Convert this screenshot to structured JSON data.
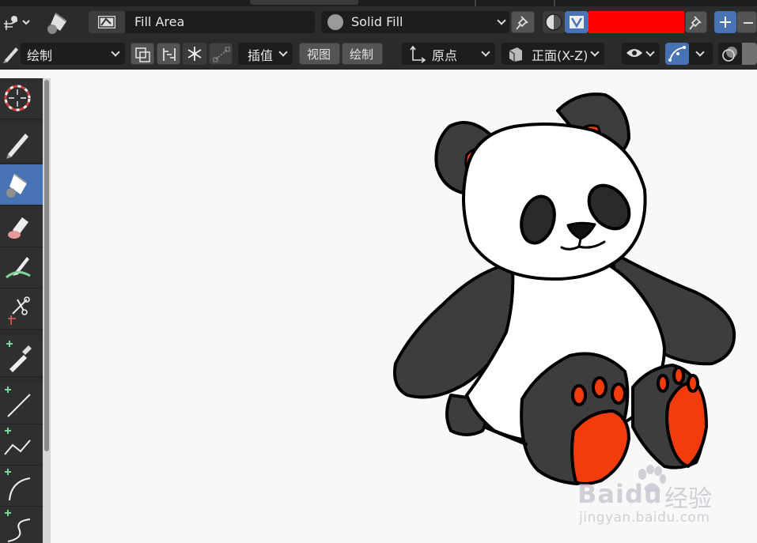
{
  "header": {
    "fill_label": "Fill Area",
    "material_mode": "Solid Fill",
    "swatch_color": "#ff0000"
  },
  "tool_settings": {
    "mode": "绘制",
    "interpolate": "插值",
    "view": "视图",
    "draw": "绘制",
    "pivot": "原点",
    "orientation": "正面(X-Z)"
  },
  "toolbar": {
    "tools": [
      "cursor",
      "draw",
      "fill",
      "erase",
      "tint",
      "cutter",
      "eyedropper",
      "line",
      "polyline",
      "arc",
      "curve"
    ],
    "active": "fill"
  },
  "watermark": {
    "brand": "Baidu",
    "cn": "经验",
    "url": "jingyan.baidu.com"
  }
}
